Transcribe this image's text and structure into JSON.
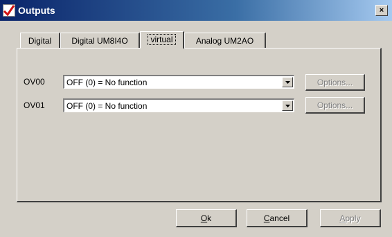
{
  "window": {
    "title": "Outputs",
    "close_symbol": "×"
  },
  "tabs": [
    {
      "label": "Digital",
      "active": false
    },
    {
      "label": "Digital UM8I4O",
      "active": false
    },
    {
      "label": "virtual",
      "active": true
    },
    {
      "label": "Analog UM2AO",
      "active": false
    }
  ],
  "rows": [
    {
      "label": "OV00",
      "value": "OFF (0) = No function",
      "options_label": "Options..."
    },
    {
      "label": "OV01",
      "value": "OFF (0) = No function",
      "options_label": "Options..."
    }
  ],
  "buttons": {
    "ok": {
      "mnemonic": "O",
      "rest": "k"
    },
    "cancel": {
      "mnemonic": "C",
      "rest": "ancel"
    },
    "apply": {
      "mnemonic": "A",
      "rest": "pply"
    }
  },
  "colors": {
    "titlebar_start": "#0a246a",
    "titlebar_end": "#a6caf0",
    "face": "#d4d0c8",
    "disabled_text": "#808080"
  },
  "icons": {
    "app": "red-check-icon",
    "close": "close-icon",
    "dropdown": "chevron-down-icon"
  }
}
